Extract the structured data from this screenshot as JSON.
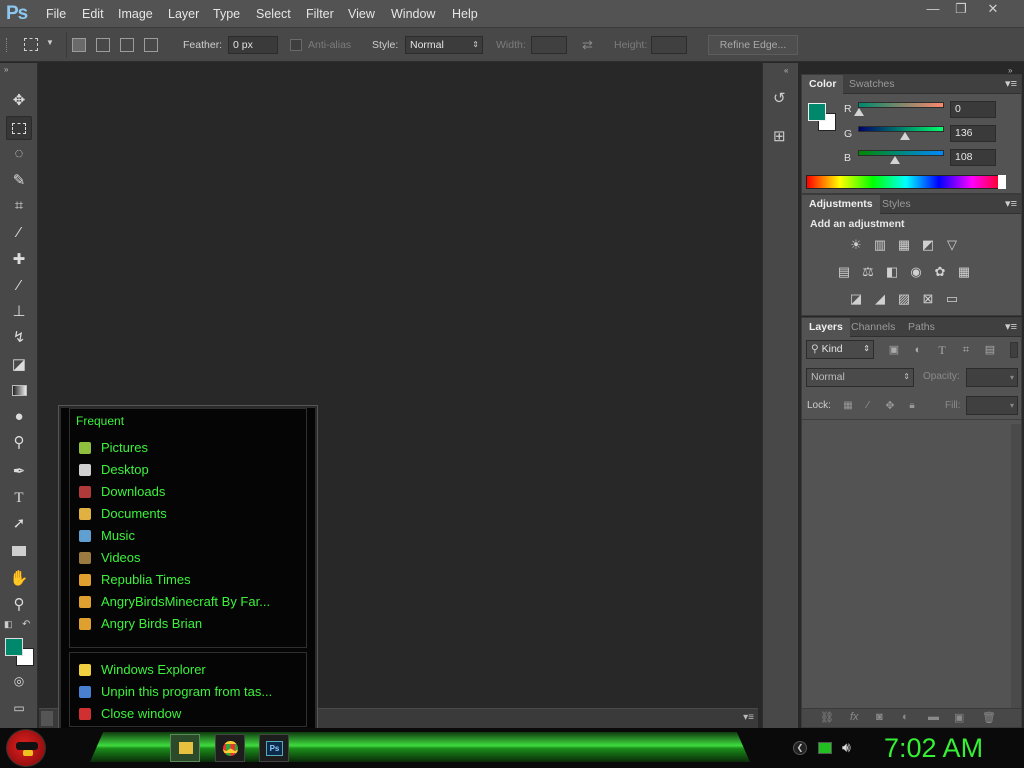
{
  "app": {
    "logo": "Ps"
  },
  "menu": [
    "File",
    "Edit",
    "Image",
    "Layer",
    "Type",
    "Select",
    "Filter",
    "View",
    "Window",
    "Help"
  ],
  "window_controls": {
    "minimize": "—",
    "restore": "❐",
    "close": "✕"
  },
  "options_bar": {
    "feather_label": "Feather:",
    "feather_value": "0 px",
    "antialias_label": "Anti-alias",
    "style_label": "Style:",
    "style_value": "Normal",
    "width_label": "Width:",
    "height_label": "Height:",
    "refine_edge": "Refine Edge..."
  },
  "color_panel": {
    "tabs": [
      "Color",
      "Swatches"
    ],
    "r_label": "R",
    "r_value": "0",
    "g_label": "G",
    "g_value": "136",
    "b_label": "B",
    "b_value": "108",
    "foreground": "#00886c"
  },
  "adjustments_panel": {
    "tabs": [
      "Adjustments",
      "Styles"
    ],
    "heading": "Add an adjustment"
  },
  "layers_panel": {
    "tabs": [
      "Layers",
      "Channels",
      "Paths"
    ],
    "kind_label": "Kind",
    "blend_mode": "Normal",
    "opacity_label": "Opacity:",
    "lock_label": "Lock:",
    "fill_label": "Fill:"
  },
  "jump_list": {
    "section_title": "Frequent",
    "frequent": [
      {
        "label": "Pictures",
        "color": "#8fbf3f"
      },
      {
        "label": "Desktop",
        "color": "#cfcfcf"
      },
      {
        "label": "Downloads",
        "color": "#b03a3a"
      },
      {
        "label": "Documents",
        "color": "#e0b040"
      },
      {
        "label": "Music",
        "color": "#5fa0d0"
      },
      {
        "label": "Videos",
        "color": "#9a7a40"
      },
      {
        "label": "Republia Times",
        "color": "#e0a030"
      },
      {
        "label": "AngryBirdsMinecraft By Far...",
        "color": "#e0a030"
      },
      {
        "label": "Angry Birds Brian",
        "color": "#e0a030"
      }
    ],
    "tasks": [
      {
        "label": "Windows Explorer",
        "color": "#f0d040"
      },
      {
        "label": "Unpin this program from tas...",
        "color": "#4a80d0"
      },
      {
        "label": "Close window",
        "color": "#d03030"
      }
    ]
  },
  "taskbar": {
    "clock": "7:02 AM"
  }
}
